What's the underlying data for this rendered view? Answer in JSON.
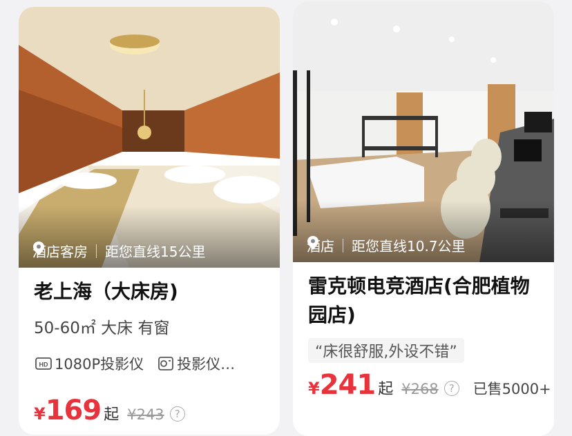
{
  "cards": [
    {
      "image": "hotel-room-king-bed",
      "tag": "酒店客房",
      "distance": "距您直线15公里",
      "title": "老上海（大床房)",
      "subtitle": "50-60㎡ 大床 有窗",
      "features": [
        "1080P投影仪",
        "投影仪…"
      ],
      "currency": "¥",
      "price": "169",
      "qi": "起",
      "original_price": "¥243",
      "help": "?"
    },
    {
      "image": "esports-hotel-room",
      "tag": "酒店",
      "distance": "距您直线10.7公里",
      "title": "雷克顿电竞酒店(合肥植物园店)",
      "review": "“床很舒服,外设不错”",
      "currency": "¥",
      "price": "241",
      "qi": "起",
      "original_price": "¥268",
      "help": "?",
      "sold": "已售5000+"
    }
  ],
  "colors": {
    "price": "#e8323c",
    "muted": "#999999"
  }
}
